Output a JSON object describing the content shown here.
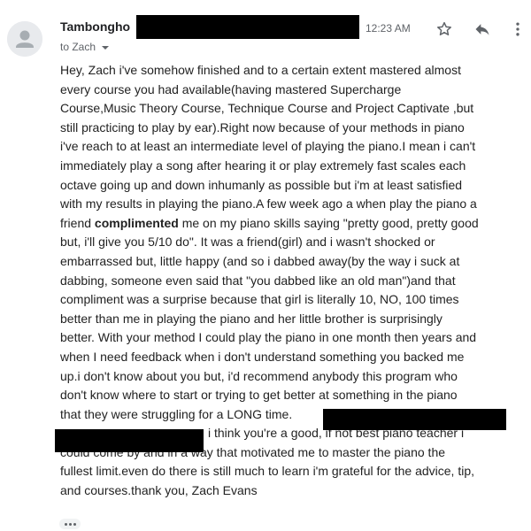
{
  "header": {
    "sender_name": "Tambongho",
    "time": "12:23 AM",
    "to_label": "to Zach"
  },
  "icons": {
    "avatar": "person-icon",
    "star": "star-icon",
    "reply": "reply-icon",
    "more": "more-vert-icon",
    "to_dropdown": "caret-down-icon",
    "show_trimmed": "ellipsis-icon"
  },
  "body": {
    "lines": [
      "Hey, Zach i've somehow finished and to a certain extent mastered almost",
      "every course you had available(having mastered Supercharge",
      "Course,Music Theory Course, Technique Course and Project Captivate ,but",
      "still practicing to play by ear).Right now because of your methods in piano",
      "i've reach to at least an intermediate level of playing the piano.I mean i can't",
      "immediately play a song after hearing it or play extremely fast scales each",
      "octave going up and down inhumanly as possible but i'm at least satisfied",
      "with my results in playing the piano.A few week ago a when play the piano a",
      "friend ",
      "complimented",
      " me on my piano skills saying \"pretty good, pretty good",
      "but, i'll give you 5/10 do\". It was a friend(girl) and i wasn't shocked or",
      "embarrassed but, little happy (and so i dabbed away(by the way i suck at",
      "dabbing, someone even said that \"you dabbed like an old man\")and that",
      "compliment was a surprise because that girl is literally 10, NO, 100 times",
      "better than me in playing the piano and her little brother is surprisingly",
      "better. With your method I could play the piano in one month then years and",
      "when I need feedback when i don't understand something you backed me",
      "up.i don't know about you but, i'd recommend anybody this program who",
      "don't know where to start or trying to get better at something in the piano",
      "that they were struggling for a LONG time.",
      "i think you're a good, if not best piano teacher i",
      "could come by and in a way that motivated me to master the piano the",
      "fullest limit.even do there is still much to learn i'm grateful for the advice, tip,",
      "and courses.thank you, Zach Evans"
    ]
  }
}
